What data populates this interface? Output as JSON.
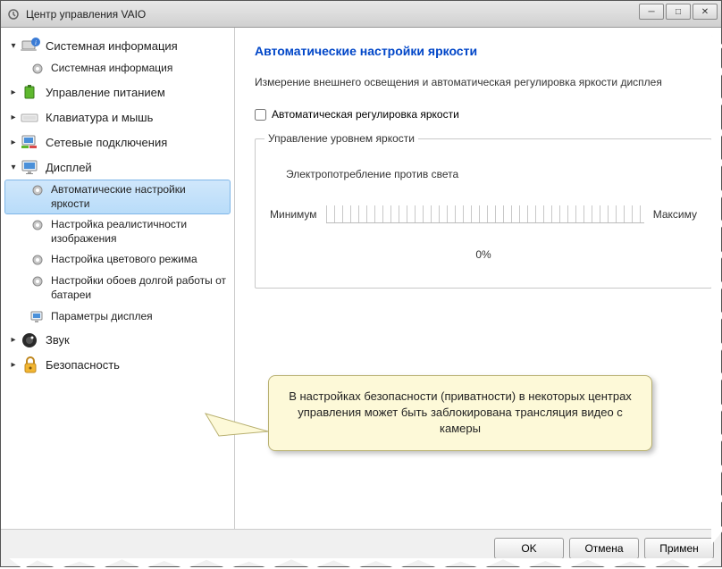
{
  "window": {
    "title": "Центр управления VAIO"
  },
  "sidebar": {
    "items": [
      {
        "label": "Системная информация",
        "expanded": true,
        "icon": "laptop-info",
        "children": [
          {
            "label": "Системная информация",
            "icon": "gear"
          }
        ]
      },
      {
        "label": "Управление питанием",
        "expanded": false,
        "icon": "battery"
      },
      {
        "label": "Клавиатура и мышь",
        "expanded": false,
        "icon": "keyboard"
      },
      {
        "label": "Сетевые подключения",
        "expanded": false,
        "icon": "network"
      },
      {
        "label": "Дисплей",
        "expanded": true,
        "icon": "monitor",
        "children": [
          {
            "label": "Автоматические настройки яркости",
            "icon": "gear",
            "selected": true
          },
          {
            "label": "Настройка реалистичности изображения",
            "icon": "gear"
          },
          {
            "label": "Настройка цветового режима",
            "icon": "gear"
          },
          {
            "label": "Настройки обоев долгой работы от батареи",
            "icon": "gear"
          },
          {
            "label": "Параметры дисплея",
            "icon": "monitor-small"
          }
        ]
      },
      {
        "label": "Звук",
        "expanded": false,
        "icon": "speaker"
      },
      {
        "label": "Безопасность",
        "expanded": false,
        "icon": "lock"
      }
    ]
  },
  "content": {
    "heading": "Автоматические настройки яркости",
    "description": "Измерение внешнего освещения и автоматическая регулировка яркости дисплея",
    "checkbox_label": "Автоматическая регулировка яркости",
    "checkbox_checked": false,
    "group_legend": "Управление уровнем яркости",
    "group_row1": "Электропотребление против света",
    "slider_min": "Минимум",
    "slider_max": "Максиму",
    "percent": "0%"
  },
  "callout": {
    "text": "В настройках безопасности (приватности) в некоторых центрах управления может быть заблокирована трансляция видео с камеры"
  },
  "footer": {
    "ok": "OK",
    "cancel": "Отмена",
    "apply": "Примен"
  }
}
